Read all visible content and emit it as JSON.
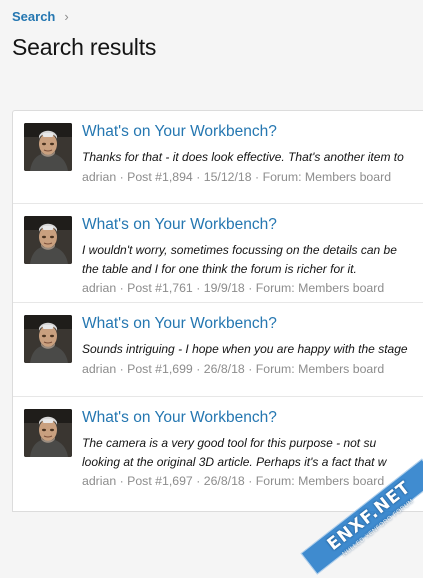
{
  "breadcrumb": {
    "label": "Search",
    "separator": "›"
  },
  "page": {
    "title": "Search results"
  },
  "results": [
    {
      "title": "What's on Your Workbench?",
      "snippet_lines": [
        "Thanks for that - it does look effective. That's another item to"
      ],
      "author": "adrian",
      "post": "Post #1,894",
      "date": "15/12/18",
      "forum": "Forum: Members board"
    },
    {
      "title": "What's on Your Workbench?",
      "snippet_lines": [
        "I wouldn't worry, sometimes focussing on the details can be",
        "the table and I for one think the forum is richer for it."
      ],
      "author": "adrian",
      "post": "Post #1,761",
      "date": "19/9/18",
      "forum": "Forum: Members board"
    },
    {
      "title": "What's on Your Workbench?",
      "snippet_lines": [
        "Sounds intriguing - I hope when you are happy with the stage"
      ],
      "author": "adrian",
      "post": "Post #1,699",
      "date": "26/8/18",
      "forum": "Forum: Members board"
    },
    {
      "title": "What's on Your Workbench?",
      "snippet_lines": [
        "The camera is a very good tool for this purpose - not su",
        "looking at the original 3D article. Perhaps it's a fact that w"
      ],
      "author": "adrian",
      "post": "Post #1,697",
      "date": "26/8/18",
      "forum": "Forum: Members board"
    }
  ],
  "meta_separator": "·",
  "watermark": {
    "text": "ENXF.NET",
    "subtext": "NULLED XENFORO FORUM"
  },
  "colors": {
    "link": "#2577b1",
    "muted": "#8c8c8c",
    "text": "#141414",
    "background": "#f5f5f5"
  }
}
